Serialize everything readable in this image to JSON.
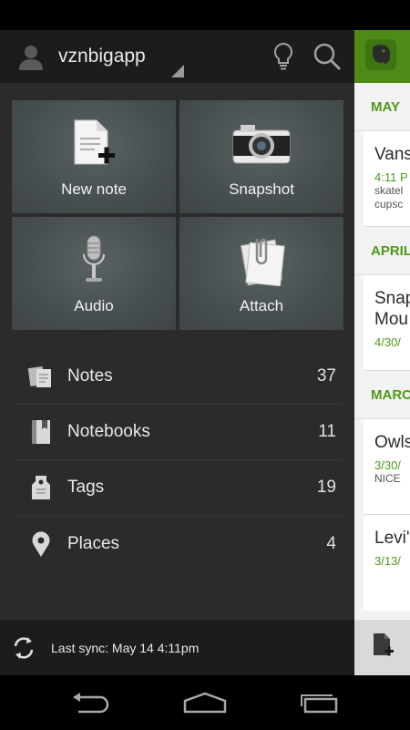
{
  "account": {
    "name": "vznbigapp"
  },
  "tiles": [
    {
      "label": "New note"
    },
    {
      "label": "Snapshot"
    },
    {
      "label": "Audio"
    },
    {
      "label": "Attach"
    }
  ],
  "nav": [
    {
      "label": "Notes",
      "count": "37",
      "icon": "notes-icon"
    },
    {
      "label": "Notebooks",
      "count": "11",
      "icon": "notebook-icon"
    },
    {
      "label": "Tags",
      "count": "19",
      "icon": "tag-icon"
    },
    {
      "label": "Places",
      "count": "4",
      "icon": "map-pin-icon"
    }
  ],
  "sync": {
    "label": "Last sync: May 14 4:11pm"
  },
  "note_list": {
    "sections": [
      {
        "header": "MAY",
        "notes": [
          {
            "title": "Vans",
            "date": "4:11 P",
            "snippet1": "skatel",
            "snippet2": "cupsc"
          }
        ]
      },
      {
        "header": "APRIL",
        "notes": [
          {
            "title": "Snap",
            "title2": "Mou",
            "date": "4/30/"
          }
        ]
      },
      {
        "header": "MARC",
        "notes": [
          {
            "title": "Owls",
            "date": "3/30/",
            "snippet1": "NICE"
          },
          {
            "title": "Levi'",
            "date": "3/13/"
          }
        ]
      }
    ]
  },
  "colors": {
    "accent_green": "#4e8b16",
    "drawer_bg": "#2b2b2b",
    "topbar_bg": "#1c1c1c"
  }
}
